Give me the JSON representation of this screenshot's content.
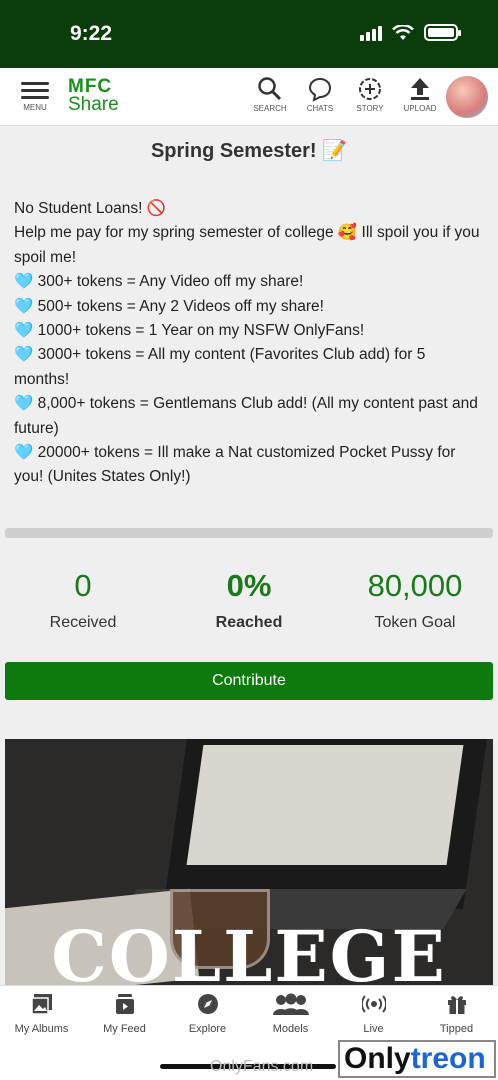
{
  "status": {
    "time": "9:22"
  },
  "header": {
    "menu_label": "MENU",
    "logo_line1": "MFC",
    "logo_line2": "Share",
    "icons": [
      {
        "name": "search-icon",
        "label": "SEARCH"
      },
      {
        "name": "chats-icon",
        "label": "CHATS"
      },
      {
        "name": "story-icon",
        "label": "STORY"
      },
      {
        "name": "upload-icon",
        "label": "UPLOAD"
      }
    ]
  },
  "goal": {
    "title": "Spring Semester! 📝",
    "lines": [
      "No Student Loans! 🚫",
      "Help me pay for my spring semester of college 🥰 Ill spoil you if you spoil me!",
      "🩵 300+ tokens = Any Video off my share!",
      "🩵 500+ tokens = Any 2 Videos off my share!",
      "🩵 1000+ tokens = 1 Year on my NSFW OnlyFans!",
      "🩵 3000+ tokens = All my content (Favorites Club add) for 5 months!",
      "🩵 8,000+ tokens = Gentlemans Club add! (All my content past and future)",
      "🩵 20000+ tokens = Ill make a Nat customized Pocket Pussy for you! (Unites States Only!)"
    ],
    "progress_fraction": 0,
    "stats": {
      "received_value": "0",
      "received_label": "Received",
      "reached_value": "0%",
      "reached_label": "Reached",
      "goal_value": "80,000",
      "goal_label": "Token Goal"
    },
    "contribute_label": "Contribute",
    "image_text": "COLLEGE"
  },
  "bottom_nav": [
    {
      "name": "my-albums",
      "label": "My Albums"
    },
    {
      "name": "my-feed",
      "label": "My Feed"
    },
    {
      "name": "explore",
      "label": "Explore"
    },
    {
      "name": "models",
      "label": "Models"
    },
    {
      "name": "live",
      "label": "Live"
    },
    {
      "name": "tipped",
      "label": "Tipped"
    }
  ],
  "watermark": {
    "left": "OnlyFans.com",
    "right_1": "Only",
    "right_2": "treon"
  },
  "colors": {
    "brand_green": "#1a8f1a",
    "status_bar": "#0b3d0b",
    "button": "#0c7a0c"
  }
}
